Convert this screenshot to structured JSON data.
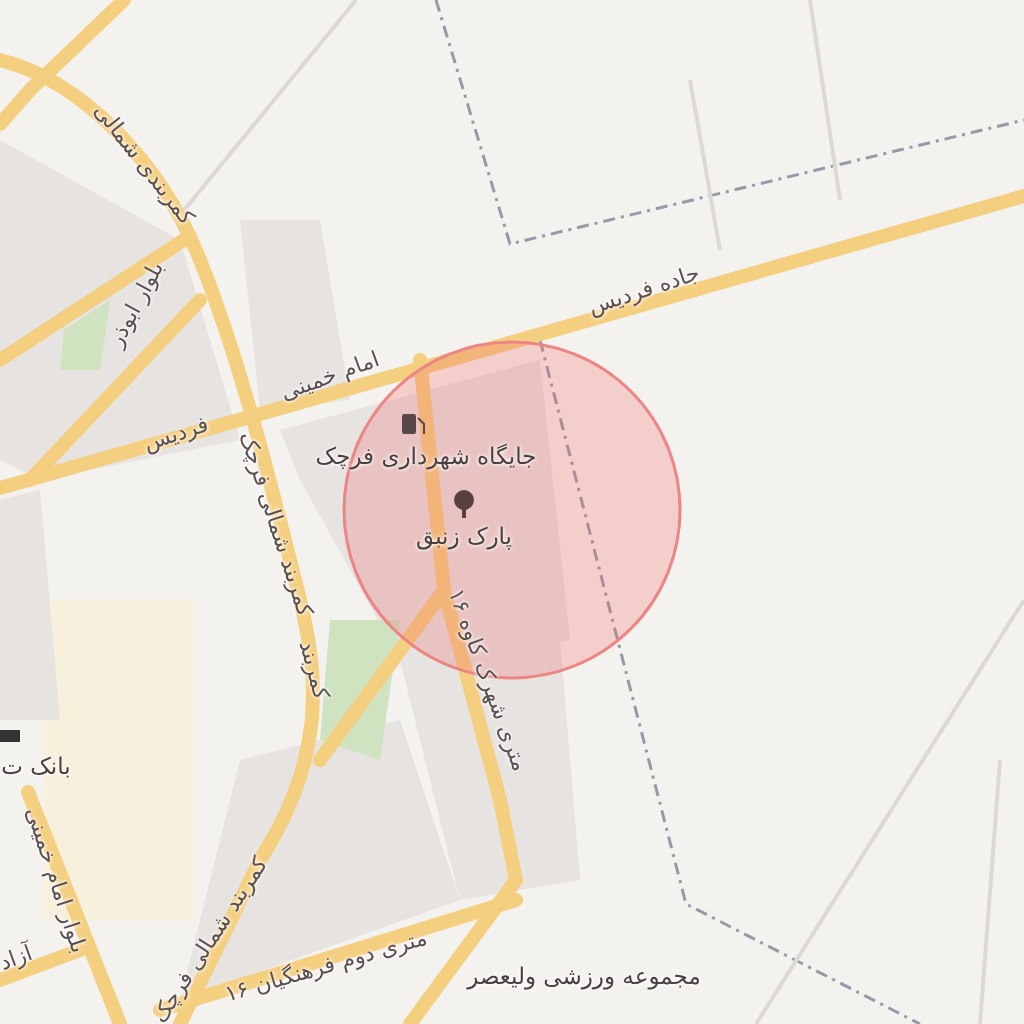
{
  "map": {
    "labels": [
      {
        "text": "کمربندی شمالی",
        "kind": "road"
      },
      {
        "text": "بلوار ابوذر",
        "kind": "road"
      },
      {
        "text": "امام خمینی",
        "kind": "road"
      },
      {
        "text": "فردیس",
        "kind": "road"
      },
      {
        "text": "جاده فردیس",
        "kind": "road"
      },
      {
        "text": "جایگاه شهرداری فرچک",
        "kind": "place"
      },
      {
        "text": "پارک زنبق",
        "kind": "place"
      },
      {
        "text": "کمربند شمالی فرچک",
        "kind": "road"
      },
      {
        "text": "۱۶ متری شهرک کاوه",
        "kind": "road"
      },
      {
        "text": "بانک ت",
        "kind": "place"
      },
      {
        "text": "بلوار امام خمینی",
        "kind": "road"
      },
      {
        "text": "آزاد",
        "kind": "road"
      },
      {
        "text": "کمربند",
        "kind": "road"
      },
      {
        "text": "کمربند شمالی فرچک",
        "kind": "road"
      },
      {
        "text": "۱۶ متری دوم فرهنگیان",
        "kind": "road"
      },
      {
        "text": "مجموعه ورزشی ولیعصر",
        "kind": "place"
      }
    ]
  }
}
